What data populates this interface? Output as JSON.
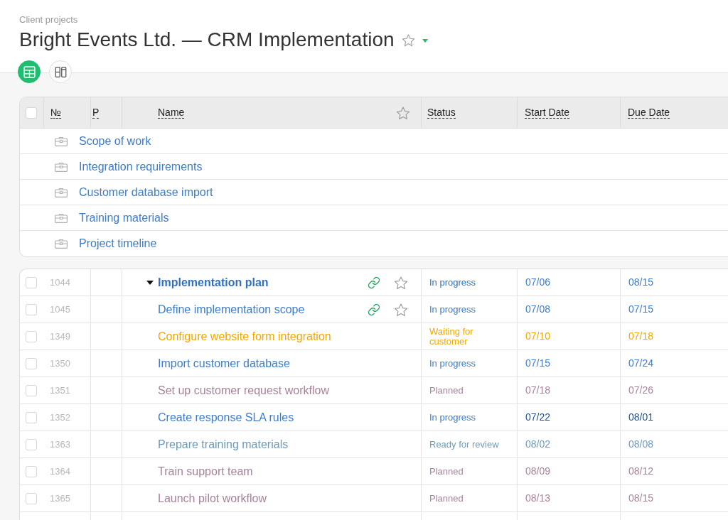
{
  "breadcrumb": "Client projects",
  "title": {
    "text": "Bright Events Ltd. — CRM Implementation",
    "favorite": false
  },
  "views": [
    {
      "kind": "table",
      "selected": true
    },
    {
      "kind": "board",
      "selected": false
    }
  ],
  "table": {
    "select_all": {
      "checked": false
    },
    "columns": [
      "№",
      "P",
      "Name",
      "Status",
      "Start Date",
      "Due Date"
    ]
  },
  "groups": [
    {
      "name": "Scope of work"
    },
    {
      "name": "Integration requirements"
    },
    {
      "name": "Customer database import"
    },
    {
      "name": "Training materials"
    },
    {
      "name": "Project timeline"
    }
  ],
  "tasks": [
    {
      "number": "1044",
      "name": "Implementation plan",
      "checked": false,
      "expanded": true,
      "attachment": true,
      "favorite": false,
      "status": "In progress",
      "start_date": {
        "text": "07/06",
        "color": "#3d7cc9"
      },
      "due_date": {
        "text": "08/15",
        "color": "#3d7cc9"
      },
      "color": "#2f6fc4",
      "children": [
        {
          "number": "1045",
          "name": "Define implementation scope",
          "checked": false,
          "attachment": true,
          "favorite": false,
          "status": "In progress",
          "start_date": {
            "text": "07/08",
            "color": "#3d7cc9"
          },
          "due_date": {
            "text": "07/15",
            "color": "#3d7cc9"
          },
          "color": "#3d7cc9"
        },
        {
          "number": "1349",
          "name": "Configure website form integration",
          "checked": false,
          "status": "Waiting for customer",
          "start_date": {
            "text": "07/10",
            "color": "#f2a600"
          },
          "due_date": {
            "text": "07/18",
            "color": "#f2a600"
          },
          "color": "#f2a600"
        },
        {
          "number": "1350",
          "name": "Import customer database",
          "checked": false,
          "status": "In progress",
          "start_date": {
            "text": "07/15",
            "color": "#3d7cc9"
          },
          "due_date": {
            "text": "07/24",
            "color": "#3d7cc9"
          },
          "color": "#3d7cc9"
        },
        {
          "number": "1351",
          "name": "Set up customer request workflow",
          "checked": false,
          "status": "Planned",
          "start_date": {
            "text": "07/18",
            "color": "#a6829a"
          },
          "due_date": {
            "text": "07/26",
            "color": "#a6829a"
          },
          "color": "#a6829a"
        },
        {
          "number": "1352",
          "name": "Create response SLA rules",
          "checked": false,
          "status": "In progress",
          "start_date": {
            "text": "07/22",
            "color": "#1d4f8f"
          },
          "due_date": {
            "text": "08/01",
            "color": "#1d4f8f"
          },
          "color": "#3d7cc9"
        },
        {
          "number": "1363",
          "name": "Prepare training materials",
          "checked": false,
          "status": "Ready for review",
          "start_date": {
            "text": "08/02",
            "color": "#6d9ab8"
          },
          "due_date": {
            "text": "08/08",
            "color": "#6d9ab8"
          },
          "color": "#6d9ab8"
        },
        {
          "number": "1364",
          "name": "Train support team",
          "checked": false,
          "status": "Planned",
          "start_date": {
            "text": "08/09",
            "color": "#a6829a"
          },
          "due_date": {
            "text": "08/12",
            "color": "#a6829a"
          },
          "color": "#a6829a"
        },
        {
          "number": "1365",
          "name": "Launch pilot workflow",
          "checked": false,
          "status": "Planned",
          "start_date": {
            "text": "08/13",
            "color": "#a6829a"
          },
          "due_date": {
            "text": "08/15",
            "color": "#a6829a"
          },
          "color": "#a6829a"
        }
      ]
    }
  ]
}
